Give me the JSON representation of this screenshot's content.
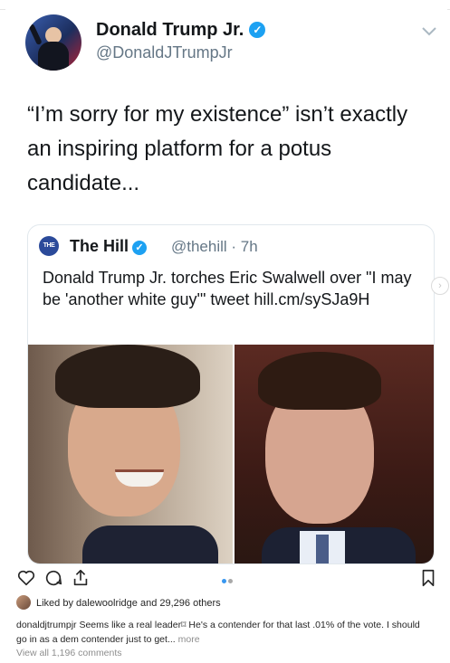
{
  "tweet": {
    "author_name": "Donald Trump Jr.",
    "author_handle": "@DonaldJTrumpJr",
    "text": "“I’m sorry for my existence” isn’t exactly an inspiring platform for a potus candidate...",
    "quoted": {
      "logo_text": "THE HILL",
      "name": "The Hill",
      "handle_time": "@thehill · 7h",
      "text": "Donald Trump Jr. torches Eric Swalwell over \"I may be 'another white guy'\" tweet hill.cm/sySJa9H"
    }
  },
  "instagram": {
    "likes_text": "Liked by dalewoolridge and 29,296 others",
    "caption_user": "donaldjtrumpjr",
    "caption_text": "Seems like a real leader⌑ He's a contender for that last .01% of the vote. I should go in as a dem contender just to get...",
    "more_label": "more",
    "view_all_comments": "View all 1,196 comments",
    "carousel_active": 1,
    "carousel_count": 2
  },
  "colors": {
    "twitter_blue": "#1da1f2",
    "verified_badge": "#1da1f2",
    "text_primary": "#14171a",
    "text_secondary": "#657786",
    "carousel_active": "#3897f0",
    "carousel_inactive": "#a8a8a8"
  },
  "icons": {
    "verified": "verified-badge-icon",
    "chevron": "chevron-down-icon",
    "like": "heart-icon",
    "comment": "comment-icon",
    "share": "share-icon",
    "save": "bookmark-icon",
    "next": "chevron-right-icon"
  }
}
